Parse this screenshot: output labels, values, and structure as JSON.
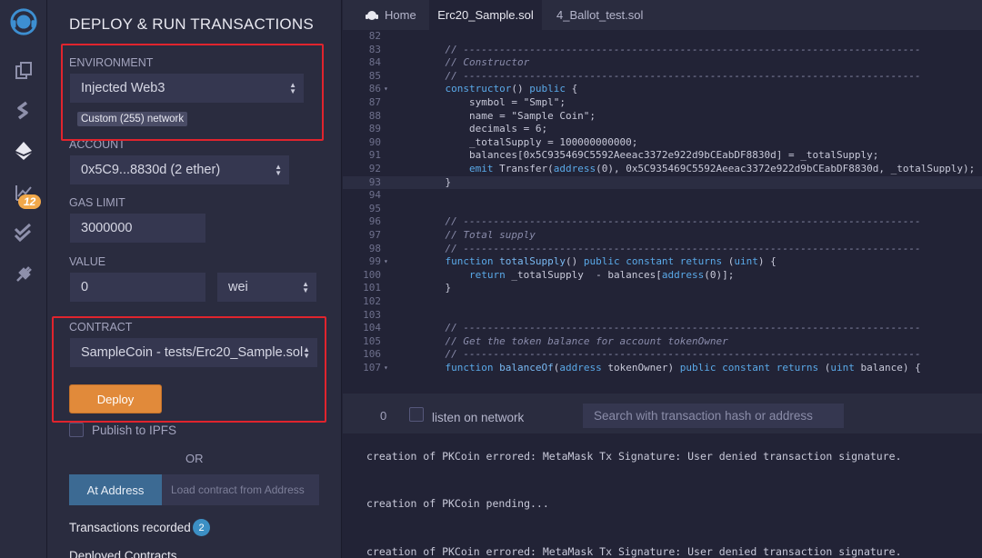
{
  "rail": {
    "icons": [
      "remix-logo-icon",
      "file-explorer-icon",
      "compile-icon",
      "deploy-run-icon",
      "analysis-icon",
      "testing-icon",
      "plugin-icon"
    ],
    "analysis_badge": "12"
  },
  "panel": {
    "title": "DEPLOY & RUN TRANSACTIONS",
    "environment": {
      "label": "ENVIRONMENT",
      "value": "Injected Web3",
      "network_badge": "Custom (255) network"
    },
    "account": {
      "label": "ACCOUNT",
      "value": "0x5C9...8830d (2 ether)"
    },
    "gas_limit": {
      "label": "GAS LIMIT",
      "value": "3000000"
    },
    "value": {
      "label": "VALUE",
      "amount": "0",
      "unit": "wei"
    },
    "contract": {
      "label": "CONTRACT",
      "value": "SampleCoin - tests/Erc20_Sample.sol"
    },
    "deploy_label": "Deploy",
    "publish_label": "Publish to IPFS",
    "or_label": "OR",
    "at_address_label": "At Address",
    "at_address_placeholder": "Load contract from Address",
    "transactions_recorded_label": "Transactions recorded",
    "transactions_recorded_count": "2",
    "deployed_contracts_label": "Deployed Contracts"
  },
  "tabs": [
    {
      "label": "Home",
      "active": false
    },
    {
      "label": "Erc20_Sample.sol",
      "active": true
    },
    {
      "label": "4_Ballot_test.sol",
      "active": false
    }
  ],
  "editor": {
    "lines": [
      {
        "n": "82",
        "html": ""
      },
      {
        "n": "83",
        "html": "    <span class=\"cm\">// ----------------------------------------------------------------------------</span>"
      },
      {
        "n": "84",
        "html": "    <span class=\"cm\">// Constructor</span>"
      },
      {
        "n": "85",
        "html": "    <span class=\"cm\">// ----------------------------------------------------------------------------</span>"
      },
      {
        "n": "86",
        "fold": true,
        "html": "    <span class=\"kw\">constructor</span>() <span class=\"kw\">public</span> {"
      },
      {
        "n": "87",
        "html": "        symbol = \"Smpl\";"
      },
      {
        "n": "88",
        "html": "        name = \"Sample Coin\";"
      },
      {
        "n": "89",
        "html": "        decimals = 6;"
      },
      {
        "n": "90",
        "html": "        _totalSupply = 100000000000;"
      },
      {
        "n": "91",
        "html": "        balances[0x5C935469C5592Aeeac3372e922d9bCEabDF8830d] = _totalSupply;"
      },
      {
        "n": "92",
        "html": "        <span class=\"kw\">emit</span> Transfer(<span class=\"kw\">address</span>(0), 0x5C935469C5592Aeeac3372e922d9bCEabDF8830d, _totalSupply);"
      },
      {
        "n": "93",
        "cur": true,
        "html": "    }"
      },
      {
        "n": "94",
        "html": ""
      },
      {
        "n": "95",
        "html": ""
      },
      {
        "n": "96",
        "html": "    <span class=\"cm\">// ----------------------------------------------------------------------------</span>"
      },
      {
        "n": "97",
        "html": "    <span class=\"cm\">// Total supply</span>"
      },
      {
        "n": "98",
        "html": "    <span class=\"cm\">// ----------------------------------------------------------------------------</span>"
      },
      {
        "n": "99",
        "fold": true,
        "html": "    <span class=\"kw\">function</span> <span class=\"fn\">totalSupply</span>() <span class=\"kw\">public constant returns</span> (<span class=\"kw\">uint</span>) {"
      },
      {
        "n": "100",
        "html": "        <span class=\"kw\">return</span> _totalSupply  - balances[<span class=\"kw\">address</span>(0)];"
      },
      {
        "n": "101",
        "html": "    }"
      },
      {
        "n": "102",
        "html": ""
      },
      {
        "n": "103",
        "html": ""
      },
      {
        "n": "104",
        "html": "    <span class=\"cm\">// ----------------------------------------------------------------------------</span>"
      },
      {
        "n": "105",
        "html": "    <span class=\"cm\">// Get the token balance for account tokenOwner</span>"
      },
      {
        "n": "106",
        "html": "    <span class=\"cm\">// ----------------------------------------------------------------------------</span>"
      },
      {
        "n": "107",
        "fold": true,
        "html": "    <span class=\"kw\">function</span> <span class=\"fn\">balanceOf</span>(<span class=\"kw\">address</span> tokenOwner) <span class=\"kw\">public constant returns</span> (<span class=\"kw\">uint</span> balance) {"
      }
    ]
  },
  "terminal": {
    "pending_count": "0",
    "listen_label": "listen on network",
    "search_placeholder": "Search with transaction hash or address",
    "logs": [
      "creation of PKCoin errored: MetaMask Tx Signature: User denied transaction signature.",
      "creation of PKCoin pending...",
      "creation of PKCoin errored: MetaMask Tx Signature: User denied transaction signature."
    ]
  },
  "colors": {
    "highlight_box": "#e0242d",
    "deploy_button": "#e18a3a",
    "at_address_button": "#3c6a93"
  }
}
